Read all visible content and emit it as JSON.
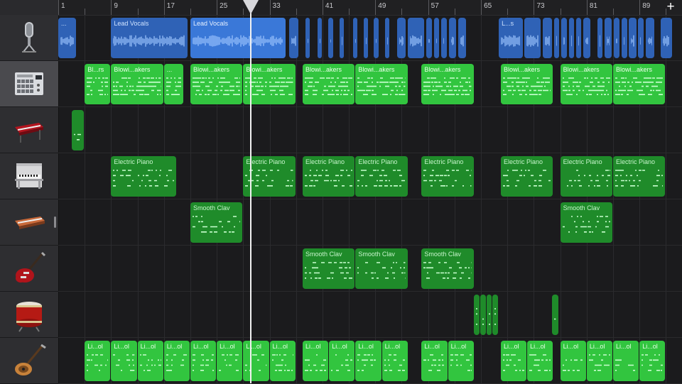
{
  "ruler": {
    "bar_labels": [
      "1",
      "9",
      "17",
      "25",
      "33",
      "41",
      "49",
      "57",
      "65",
      "73",
      "81",
      "89"
    ],
    "add_label": "+"
  },
  "colors": {
    "audio_region": "#2f62b6",
    "audio_region_selected": "#3a78d8",
    "audio_wave": "#9ec6ff",
    "midi_bright": "#32c53f",
    "midi_dark": "#1f8b2a",
    "midi_note": "#c9ffd0",
    "background": "#1b1b1d"
  },
  "tracks": [
    {
      "instrument": "microphone-icon"
    },
    {
      "instrument": "drum-machine-icon"
    },
    {
      "instrument": "synth-keyboard-icon"
    },
    {
      "instrument": "upright-piano-icon"
    },
    {
      "instrument": "clavinet-icon"
    },
    {
      "instrument": "electric-guitar-icon"
    },
    {
      "instrument": "drum-icon"
    },
    {
      "instrument": "bass-guitar-icon"
    }
  ],
  "regions": {
    "t0": [
      {
        "start": 1,
        "end": 3.7,
        "label": "...",
        "kind": "audio"
      },
      {
        "start": 9,
        "end": 20.6,
        "label": "Lead Vocals",
        "kind": "audio"
      },
      {
        "start": 21,
        "end": 35.4,
        "label": "Lead Vocals",
        "kind": "audio_sel"
      },
      {
        "start": 36,
        "end": 37.4,
        "label": "",
        "kind": "audio"
      },
      {
        "start": 38.4,
        "end": 39.1,
        "label": "",
        "kind": "audio"
      },
      {
        "start": 40.3,
        "end": 40.9,
        "label": "",
        "kind": "audio"
      },
      {
        "start": 41.9,
        "end": 42.6,
        "label": "",
        "kind": "audio"
      },
      {
        "start": 43.6,
        "end": 44.2,
        "label": "",
        "kind": "audio"
      },
      {
        "start": 45.6,
        "end": 46.3,
        "label": "",
        "kind": "audio"
      },
      {
        "start": 47.2,
        "end": 47.8,
        "label": "",
        "kind": "audio"
      },
      {
        "start": 48.8,
        "end": 49.5,
        "label": "",
        "kind": "audio"
      },
      {
        "start": 50.5,
        "end": 51.1,
        "label": "",
        "kind": "audio"
      },
      {
        "start": 52.3,
        "end": 53.6,
        "label": "",
        "kind": "audio"
      },
      {
        "start": 53.9,
        "end": 56.4,
        "label": "",
        "kind": "audio"
      },
      {
        "start": 56.7,
        "end": 57.6,
        "label": "",
        "kind": "audio"
      },
      {
        "start": 57.9,
        "end": 58.7,
        "label": "",
        "kind": "audio"
      },
      {
        "start": 59.0,
        "end": 59.8,
        "label": "",
        "kind": "audio"
      },
      {
        "start": 60.1,
        "end": 61.2,
        "label": "",
        "kind": "audio"
      },
      {
        "start": 61.6,
        "end": 62.7,
        "label": "",
        "kind": "audio"
      },
      {
        "start": 67.7,
        "end": 71.3,
        "label": "L...s",
        "kind": "audio"
      },
      {
        "start": 71.6,
        "end": 74.0,
        "label": "",
        "kind": "audio"
      },
      {
        "start": 74.3,
        "end": 75.8,
        "label": "",
        "kind": "audio"
      },
      {
        "start": 76.1,
        "end": 76.8,
        "label": "",
        "kind": "audio"
      },
      {
        "start": 77.1,
        "end": 78.0,
        "label": "",
        "kind": "audio"
      },
      {
        "start": 78.3,
        "end": 79.1,
        "label": "",
        "kind": "audio"
      },
      {
        "start": 79.4,
        "end": 80.2,
        "label": "",
        "kind": "audio"
      },
      {
        "start": 80.5,
        "end": 81.6,
        "label": "",
        "kind": "audio"
      },
      {
        "start": 82.6,
        "end": 83.4,
        "label": "",
        "kind": "audio"
      },
      {
        "start": 83.7,
        "end": 84.8,
        "label": "",
        "kind": "audio"
      },
      {
        "start": 85.1,
        "end": 86.0,
        "label": "",
        "kind": "audio"
      },
      {
        "start": 86.3,
        "end": 87.1,
        "label": "",
        "kind": "audio"
      },
      {
        "start": 87.4,
        "end": 88.5,
        "label": "",
        "kind": "audio"
      },
      {
        "start": 88.8,
        "end": 89.6,
        "label": "",
        "kind": "audio"
      },
      {
        "start": 89.9,
        "end": 91.2,
        "label": "",
        "kind": "audio"
      },
      {
        "start": 92.2,
        "end": 93.9,
        "label": "",
        "kind": "audio"
      }
    ],
    "t1": [
      {
        "start": 5,
        "end": 8.9,
        "label": "Bl...rs",
        "kind": "midi_bright"
      },
      {
        "start": 9,
        "end": 16.9,
        "label": "Blowi...akers",
        "kind": "midi_bright"
      },
      {
        "start": 17,
        "end": 19.9,
        "label": "...",
        "kind": "midi_bright"
      },
      {
        "start": 21,
        "end": 28.9,
        "label": "Blowi...akers",
        "kind": "midi_bright"
      },
      {
        "start": 29,
        "end": 36.9,
        "label": "Blowi...akers",
        "kind": "midi_bright"
      },
      {
        "start": 38,
        "end": 45.9,
        "label": "Blowi...akers",
        "kind": "midi_bright"
      },
      {
        "start": 46,
        "end": 53.9,
        "label": "Blowi...akers",
        "kind": "midi_bright"
      },
      {
        "start": 56,
        "end": 63.9,
        "label": "Blowi...akers",
        "kind": "midi_bright"
      },
      {
        "start": 68,
        "end": 75.9,
        "label": "Blowi...akers",
        "kind": "midi_bright"
      },
      {
        "start": 77,
        "end": 84.9,
        "label": "Blowi...akers",
        "kind": "midi_bright"
      },
      {
        "start": 85,
        "end": 92.9,
        "label": "Blowi...akers",
        "kind": "midi_bright"
      }
    ],
    "t2": [
      {
        "start": 3,
        "end": 4.9,
        "label": "",
        "kind": "midi_dark"
      }
    ],
    "t3": [
      {
        "start": 9,
        "end": 18.9,
        "label": "Electric Piano",
        "kind": "midi_dark"
      },
      {
        "start": 29,
        "end": 36.9,
        "label": "Electric Piano",
        "kind": "midi_dark"
      },
      {
        "start": 38,
        "end": 45.9,
        "label": "Electric Piano",
        "kind": "midi_dark"
      },
      {
        "start": 46,
        "end": 53.9,
        "label": "Electric Piano",
        "kind": "midi_dark"
      },
      {
        "start": 56,
        "end": 63.9,
        "label": "Electric Piano",
        "kind": "midi_dark"
      },
      {
        "start": 68,
        "end": 75.9,
        "label": "Electric Piano",
        "kind": "midi_dark"
      },
      {
        "start": 77,
        "end": 84.9,
        "label": "Electric Piano",
        "kind": "midi_dark"
      },
      {
        "start": 85,
        "end": 92.9,
        "label": "Electric Piano",
        "kind": "midi_dark"
      }
    ],
    "t4": [
      {
        "start": 21,
        "end": 28.9,
        "label": "Smooth Clav",
        "kind": "midi_dark"
      },
      {
        "start": 77,
        "end": 84.9,
        "label": "Smooth Clav",
        "kind": "midi_dark"
      }
    ],
    "t5": [
      {
        "start": 38,
        "end": 45.9,
        "label": "Smooth Clav",
        "kind": "midi_dark"
      },
      {
        "start": 46,
        "end": 53.9,
        "label": "Smooth Clav",
        "kind": "midi_dark"
      },
      {
        "start": 56,
        "end": 63.9,
        "label": "Smooth Clav",
        "kind": "midi_dark"
      }
    ],
    "t6": [
      {
        "start": 63.9,
        "end": 64.8,
        "label": "",
        "kind": "midi_dark"
      },
      {
        "start": 64.9,
        "end": 65.7,
        "label": "",
        "kind": "midi_dark"
      },
      {
        "start": 65.8,
        "end": 66.6,
        "label": "",
        "kind": "midi_dark"
      },
      {
        "start": 66.7,
        "end": 67.6,
        "label": "",
        "kind": "midi_dark"
      },
      {
        "start": 75.8,
        "end": 76.7,
        "label": "",
        "kind": "midi_dark"
      }
    ],
    "t7": [
      {
        "start": 5,
        "end": 8.9,
        "label": "Li...ol",
        "kind": "midi_bright"
      },
      {
        "start": 9,
        "end": 12.9,
        "label": "Li...ol",
        "kind": "midi_bright"
      },
      {
        "start": 13,
        "end": 16.9,
        "label": "Li...ol",
        "kind": "midi_bright"
      },
      {
        "start": 17,
        "end": 20.9,
        "label": "Li...ol",
        "kind": "midi_bright"
      },
      {
        "start": 21,
        "end": 24.9,
        "label": "Li...ol",
        "kind": "midi_bright"
      },
      {
        "start": 25,
        "end": 28.9,
        "label": "Li...ol",
        "kind": "midi_bright"
      },
      {
        "start": 29,
        "end": 32.9,
        "label": "Li...ol",
        "kind": "midi_bright"
      },
      {
        "start": 33,
        "end": 36.9,
        "label": "Li...ol",
        "kind": "midi_bright"
      },
      {
        "start": 38,
        "end": 41.9,
        "label": "Li...ol",
        "kind": "midi_bright"
      },
      {
        "start": 42,
        "end": 45.9,
        "label": "Li...ol",
        "kind": "midi_bright"
      },
      {
        "start": 46,
        "end": 49.9,
        "label": "Li...ol",
        "kind": "midi_bright"
      },
      {
        "start": 50,
        "end": 53.9,
        "label": "Li...ol",
        "kind": "midi_bright"
      },
      {
        "start": 56,
        "end": 59.9,
        "label": "Li...ol",
        "kind": "midi_bright"
      },
      {
        "start": 60,
        "end": 63.9,
        "label": "Li...ol",
        "kind": "midi_bright"
      },
      {
        "start": 68,
        "end": 71.9,
        "label": "Li...ol",
        "kind": "midi_bright"
      },
      {
        "start": 72,
        "end": 75.9,
        "label": "Li...ol",
        "kind": "midi_bright"
      },
      {
        "start": 77,
        "end": 80.9,
        "label": "Li...ol",
        "kind": "midi_bright"
      },
      {
        "start": 81,
        "end": 84.9,
        "label": "Li...ol",
        "kind": "midi_bright"
      },
      {
        "start": 85,
        "end": 88.9,
        "label": "Li...ol",
        "kind": "midi_bright"
      },
      {
        "start": 89,
        "end": 92.9,
        "label": "Li...ol",
        "kind": "midi_bright"
      }
    ]
  },
  "playhead_bar": 30.2
}
